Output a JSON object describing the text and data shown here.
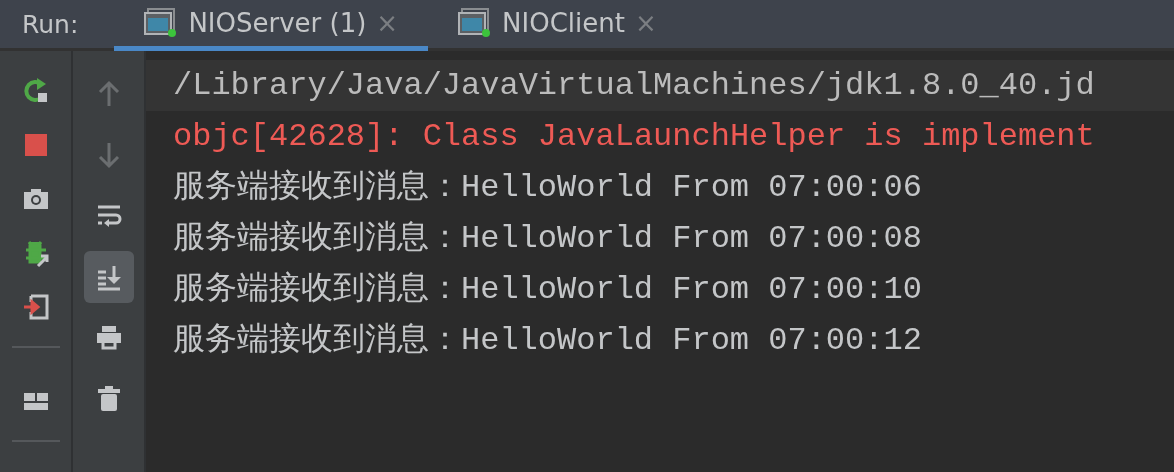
{
  "run_label": "Run:",
  "tabs": [
    {
      "label": "NIOServer (1)",
      "close": "×",
      "selected": true
    },
    {
      "label": "NIOClient",
      "close": "×",
      "selected": false
    }
  ],
  "left_toolbar": [
    {
      "kind": "rerun"
    },
    {
      "kind": "stop"
    },
    {
      "kind": "snapshot"
    },
    {
      "kind": "debug"
    },
    {
      "kind": "exit"
    },
    {
      "kind": "separator"
    },
    {
      "kind": "layout"
    },
    {
      "kind": "separator"
    }
  ],
  "right_toolbar": [
    {
      "kind": "up",
      "disabled": true,
      "selected": false
    },
    {
      "kind": "down",
      "disabled": true,
      "selected": false
    },
    {
      "kind": "wrap",
      "disabled": false,
      "selected": false
    },
    {
      "kind": "scroll",
      "disabled": false,
      "selected": true
    },
    {
      "kind": "print",
      "disabled": false,
      "selected": false
    },
    {
      "kind": "trash",
      "disabled": false,
      "selected": false
    }
  ],
  "console": [
    {
      "kind": "command",
      "text": "/Library/Java/JavaVirtualMachines/jdk1.8.0_40.jd"
    },
    {
      "kind": "error",
      "text": "objc[42628]: Class JavaLaunchHelper is implement"
    },
    {
      "kind": "output",
      "text": "服务端接收到消息：HelloWorld From 07:00:06"
    },
    {
      "kind": "output",
      "text": "服务端接收到消息：HelloWorld From 07:00:08"
    },
    {
      "kind": "output",
      "text": "服务端接收到消息：HelloWorld From 07:00:10"
    },
    {
      "kind": "output",
      "text": "服务端接收到消息：HelloWorld From 07:00:12"
    }
  ]
}
